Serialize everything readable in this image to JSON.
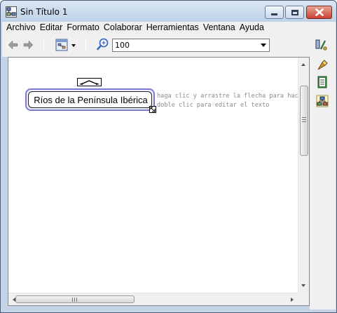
{
  "window": {
    "title": "Sin Título 1",
    "controls": [
      "minimize",
      "maximize",
      "close"
    ]
  },
  "menubar": {
    "items": [
      "Archivo",
      "Editar",
      "Formato",
      "Colaborar",
      "Herramientas",
      "Ventana",
      "Ayuda"
    ]
  },
  "toolbar": {
    "icons": [
      "back-arrow-icon",
      "forward-arrow-icon",
      "layout-styles-icon",
      "zoom-icon",
      "tools-icon"
    ],
    "zoom_value": "100"
  },
  "palette": {
    "icons": [
      "styles-icon",
      "notes-icon",
      "hierarchy-icon"
    ]
  },
  "canvas": {
    "concept": {
      "label": "Ríos de la Península Ibérica"
    },
    "hint_line_1": "haga clic y arrastre la flecha para hacer ur",
    "hint_line_2": "doble clic para editar el texto"
  },
  "scrollbars": {
    "horizontal_grip": "III",
    "vertical_grip": "≡"
  }
}
